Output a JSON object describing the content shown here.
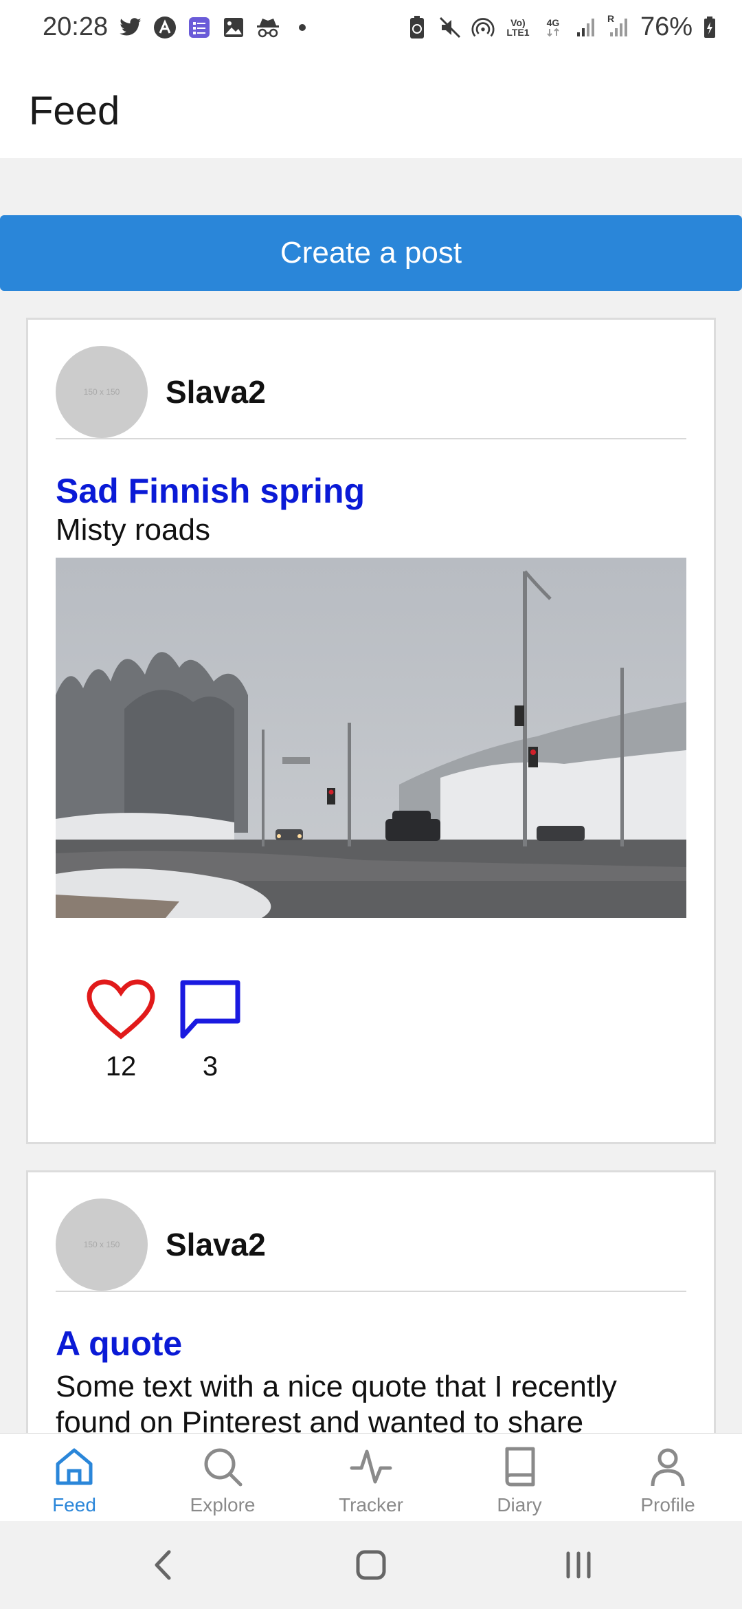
{
  "status_bar": {
    "time": "20:28",
    "battery": "76%",
    "network_top": "Vo)",
    "network_bottom": "LTE1",
    "signal_label": "4G",
    "roaming": "R",
    "left_icons": [
      "twitter-icon",
      "a-logo-icon",
      "list-app-icon",
      "gallery-icon",
      "incognito-icon",
      "dot-icon"
    ],
    "right_icons": [
      "battery-saver-icon",
      "mute-icon",
      "hotspot-icon",
      "volte-icon",
      "4g-icon",
      "signal-icon",
      "signal-roaming-icon",
      "battery-icon"
    ]
  },
  "header": {
    "title": "Feed"
  },
  "create_post": {
    "label": "Create a post"
  },
  "posts": [
    {
      "avatar_placeholder": "150 x 150",
      "author": "Slava2",
      "title": "Sad Finnish spring",
      "body": "Misty roads",
      "likes": "12",
      "comments": "3"
    },
    {
      "avatar_placeholder": "150 x 150",
      "author": "Slava2",
      "title": "A quote",
      "body": "Some text with a nice quote that I recently found on Pinterest and wanted to share"
    }
  ],
  "bottom_nav": {
    "items": [
      {
        "label": "Feed",
        "icon": "home-icon",
        "active": true
      },
      {
        "label": "Explore",
        "icon": "search-icon",
        "active": false
      },
      {
        "label": "Tracker",
        "icon": "activity-icon",
        "active": false
      },
      {
        "label": "Diary",
        "icon": "book-icon",
        "active": false
      },
      {
        "label": "Profile",
        "icon": "user-icon",
        "active": false
      }
    ]
  },
  "colors": {
    "accent": "#2a86d9",
    "post_title": "#0a1ad6",
    "like": "#e11a1a",
    "comment": "#1a1ae0"
  }
}
